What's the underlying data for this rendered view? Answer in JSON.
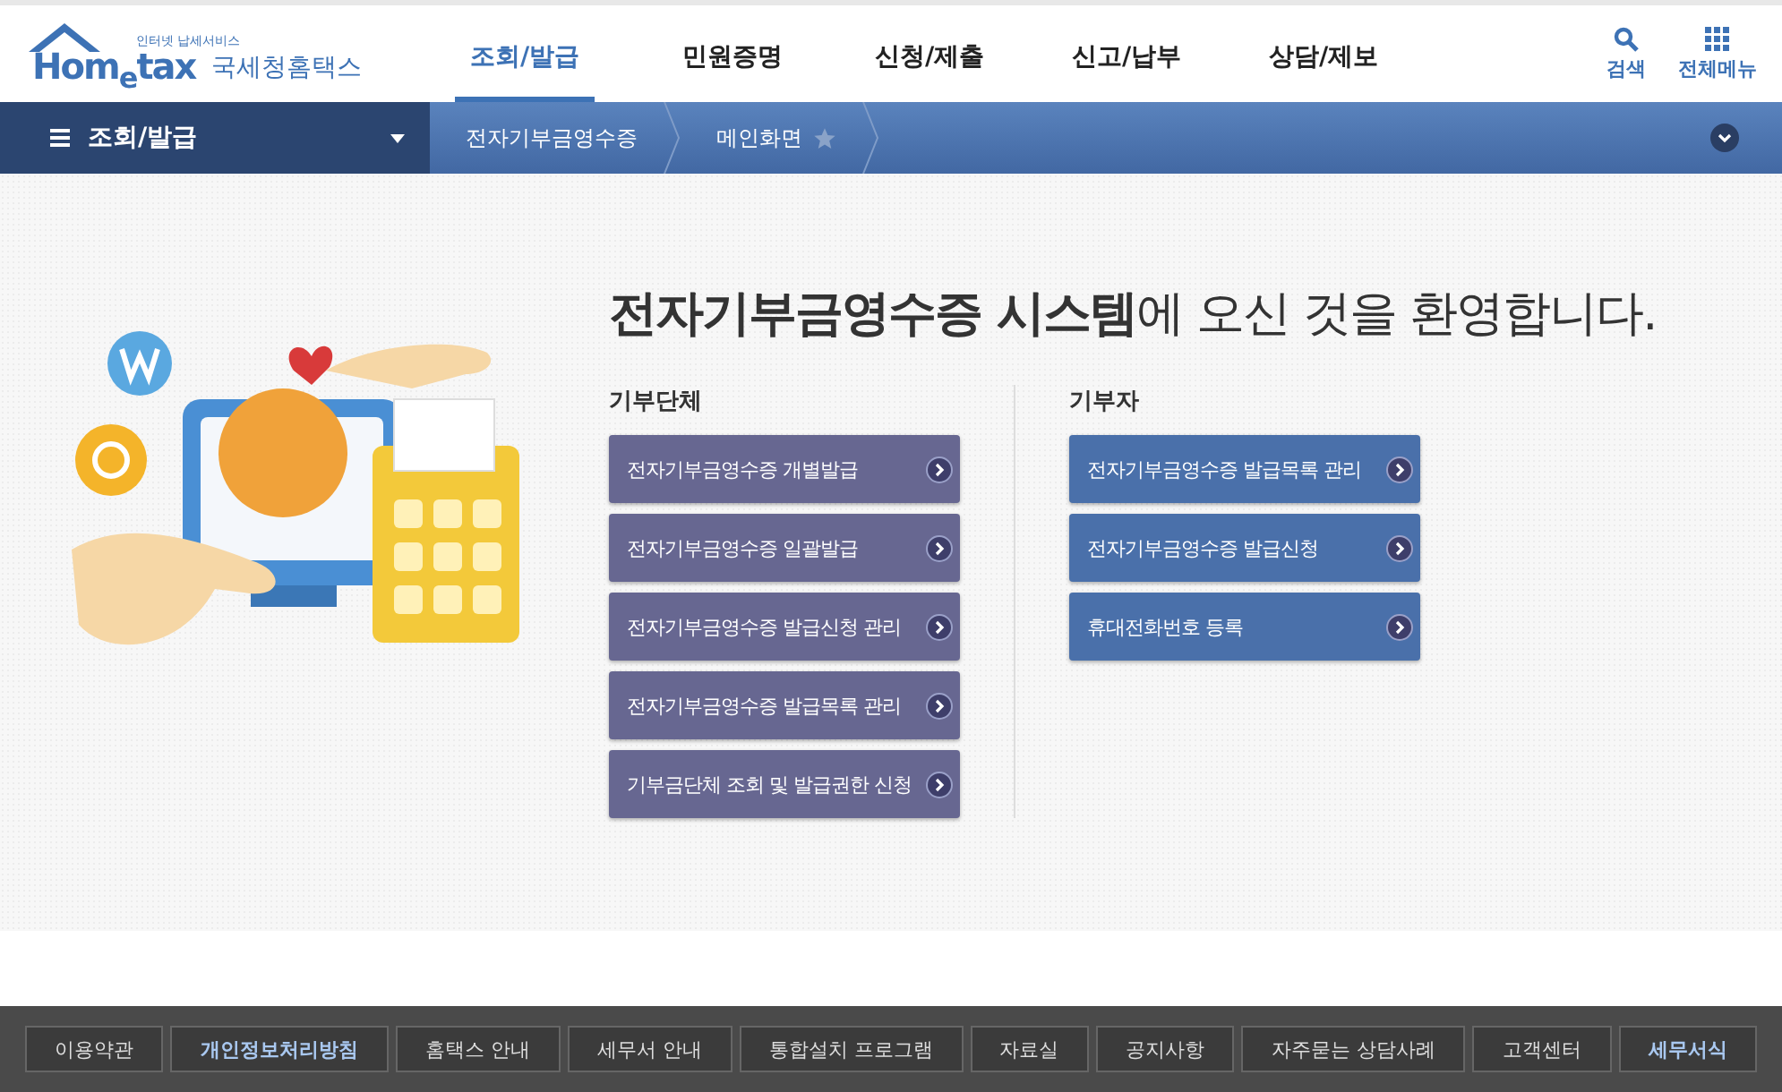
{
  "logo": {
    "tagline": "인터넷 납세서비스",
    "wordmark": "Hom$_{e}$tax",
    "name": "국세청홈택스"
  },
  "tabs": [
    {
      "label": "조회/발급",
      "selected": true
    },
    {
      "label": "민원증명",
      "selected": false
    },
    {
      "label": "신청/제출",
      "selected": false
    },
    {
      "label": "신고/납부",
      "selected": false
    },
    {
      "label": "상담/제보",
      "selected": false
    }
  ],
  "header_tools": [
    {
      "kind": "search",
      "label": "검색"
    },
    {
      "kind": "menu",
      "label": "전체메뉴"
    }
  ],
  "breadcrumb": {
    "section": "조회/발급",
    "items": [
      {
        "label": "전자기부금영수증",
        "starred": false
      },
      {
        "label": "메인화면",
        "starred": true
      }
    ]
  },
  "welcome": "**전자기부금영수증 시스템**에 오신 것을 환영합니다.",
  "groups": [
    {
      "title": "기부단체",
      "kind": "organization",
      "buttons": [
        "전자기부금영수증 개별발급",
        "전자기부금영수증 일괄발급",
        "전자기부금영수증 발급신청 관리",
        "전자기부금영수증 발급목록 관리",
        "기부금단체 조회 및 발급권한 신청"
      ]
    },
    {
      "title": "기부자",
      "kind": "donor",
      "buttons": [
        "전자기부금영수증 발급목록 관리",
        "전자기부금영수증 발급신청",
        "휴대전화번호 등록"
      ]
    }
  ],
  "footer_links": [
    {
      "label": "이용약관",
      "highlighted": false
    },
    {
      "label": "개인정보처리방침",
      "highlighted": true
    },
    {
      "label": "홈택스 안내",
      "highlighted": false
    },
    {
      "label": "세무서 안내",
      "highlighted": false
    },
    {
      "label": "통합설치 프로그램",
      "highlighted": false
    },
    {
      "label": "자료실",
      "highlighted": false
    },
    {
      "label": "공지사항",
      "highlighted": false
    },
    {
      "label": "자주묻는 상담사례",
      "highlighted": false
    },
    {
      "label": "고객센터",
      "highlighted": false
    },
    {
      "label": "세무서식",
      "highlighted": true
    }
  ]
}
